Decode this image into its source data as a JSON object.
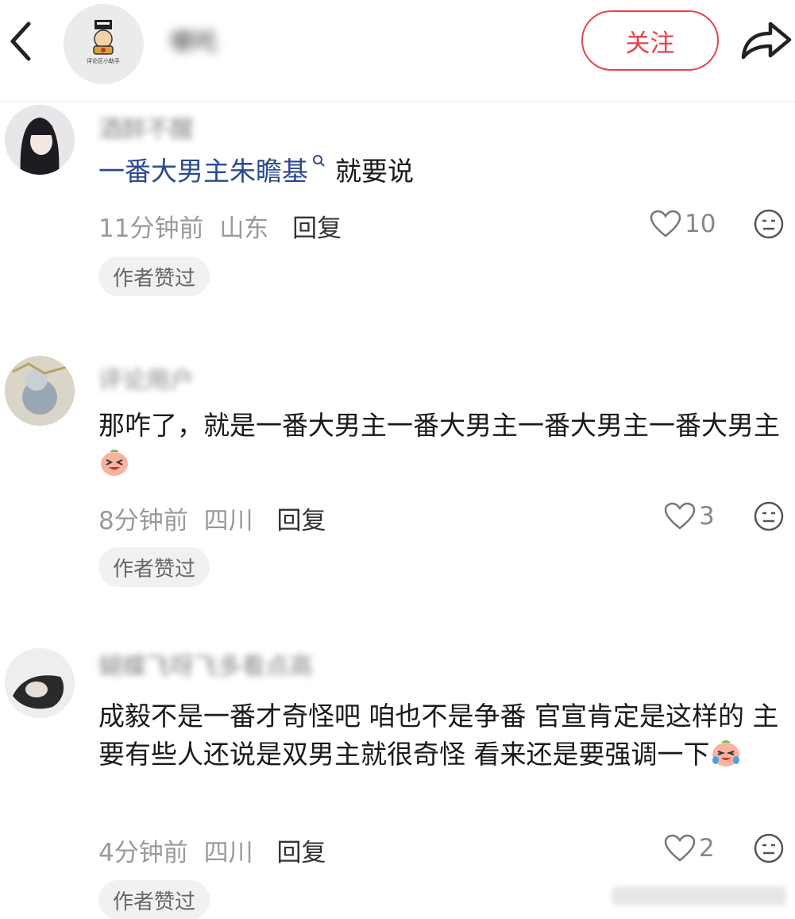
{
  "header": {
    "author_name": "哪吒",
    "logo_text": "评论区小助手",
    "follow_label": "关注",
    "back_icon": "chevron-left-icon",
    "share_icon": "share-arrow-icon"
  },
  "comments": [
    {
      "name": "酒醉不醒",
      "link_text": "一番大男主朱瞻基",
      "text": "就要说",
      "time": "11分钟前",
      "location": "山东",
      "reply_label": "回复",
      "likes": "10",
      "badge": "作者赞过"
    },
    {
      "name": "评论用户",
      "text": "那咋了，就是一番大男主一番大男主一番大男主一番大男主",
      "time": "8分钟前",
      "location": "四川",
      "reply_label": "回复",
      "likes": "3",
      "badge": "作者赞过"
    },
    {
      "name": "蝴蝶飞呀飞多看点高",
      "text": "成毅不是一番才奇怪吧 咱也不是争番 官宣肯定是这样的 主要有些人还说是双男主就很奇怪 看来还是要强调一下",
      "time": "4分钟前",
      "location": "四川",
      "reply_label": "回复",
      "likes": "2",
      "badge": "作者赞过"
    }
  ],
  "colors": {
    "accent": "#e8434a",
    "link": "#2a4b8d",
    "meta": "#9a9a9a",
    "badge_bg": "#f1f1f1"
  }
}
